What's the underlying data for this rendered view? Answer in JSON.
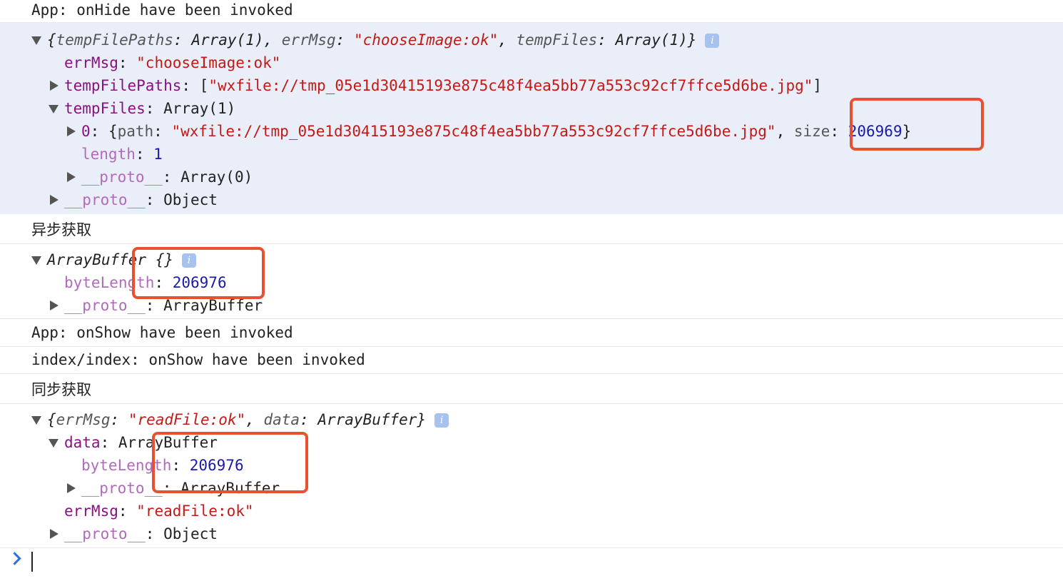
{
  "console": {
    "app_onhide": "App: onHide have been invoked",
    "obj1": {
      "summary_open": "{",
      "summary_k1": "tempFilePaths",
      "summary_v1": "Array(1)",
      "summary_k2": "errMsg",
      "summary_v2": "\"chooseImage:ok\"",
      "summary_k3": "tempFiles",
      "summary_v3": "Array(1)",
      "summary_close": "}",
      "info_icon": "i",
      "errmsg_key": "errMsg",
      "errmsg_val": "\"chooseImage:ok\"",
      "paths_key": "tempFilePaths",
      "paths_val": "\"wxfile://tmp_05e1d30415193e875c48f4ea5bb77a553c92cf7ffce5d6be.jpg\"",
      "files_key": "tempFiles",
      "files_val": "Array(1)",
      "item0_key": "0",
      "item0_path_key": "path",
      "item0_path_val": "\"wxfile://tmp_05e1d30415193e875c48f4ea5bb77a553c92cf7ffce5d6be.jpg\"",
      "item0_size_key": "size",
      "item0_size_val": "206969",
      "length_key": "length",
      "length_val": "1",
      "proto_key": "__proto__",
      "proto_arr_val": "Array(0)",
      "proto_obj_val": "Object"
    },
    "async_label": "异步获取",
    "obj2": {
      "summary": "ArrayBuffer {}",
      "info_icon": "i",
      "bytelength_key": "byteLength",
      "bytelength_val": "206976",
      "proto_key": "__proto__",
      "proto_val": "ArrayBuffer"
    },
    "app_onshow": "App: onShow have been invoked",
    "index_onshow": "index/index: onShow have been invoked",
    "sync_label": "同步获取",
    "obj3": {
      "summary_open": "{",
      "summary_k1": "errMsg",
      "summary_v1": "\"readFile:ok\"",
      "summary_k2": "data",
      "summary_v2": "ArrayBuffer",
      "summary_close": "}",
      "info_icon": "i",
      "data_key": "data",
      "data_val": "ArrayBuffer",
      "bytelength_key": "byteLength",
      "bytelength_val": "206976",
      "proto_key": "__proto__",
      "proto_ab_val": "ArrayBuffer",
      "errmsg_key": "errMsg",
      "errmsg_val": "\"readFile:ok\"",
      "proto_obj_val": "Object"
    }
  },
  "colors": {
    "highlight_box": "#e8502f",
    "selected_bg": "#e9eef9",
    "string": "#c41a16",
    "number": "#1a1aa6",
    "key": "#881280",
    "prompt": "#2f6fe4"
  }
}
